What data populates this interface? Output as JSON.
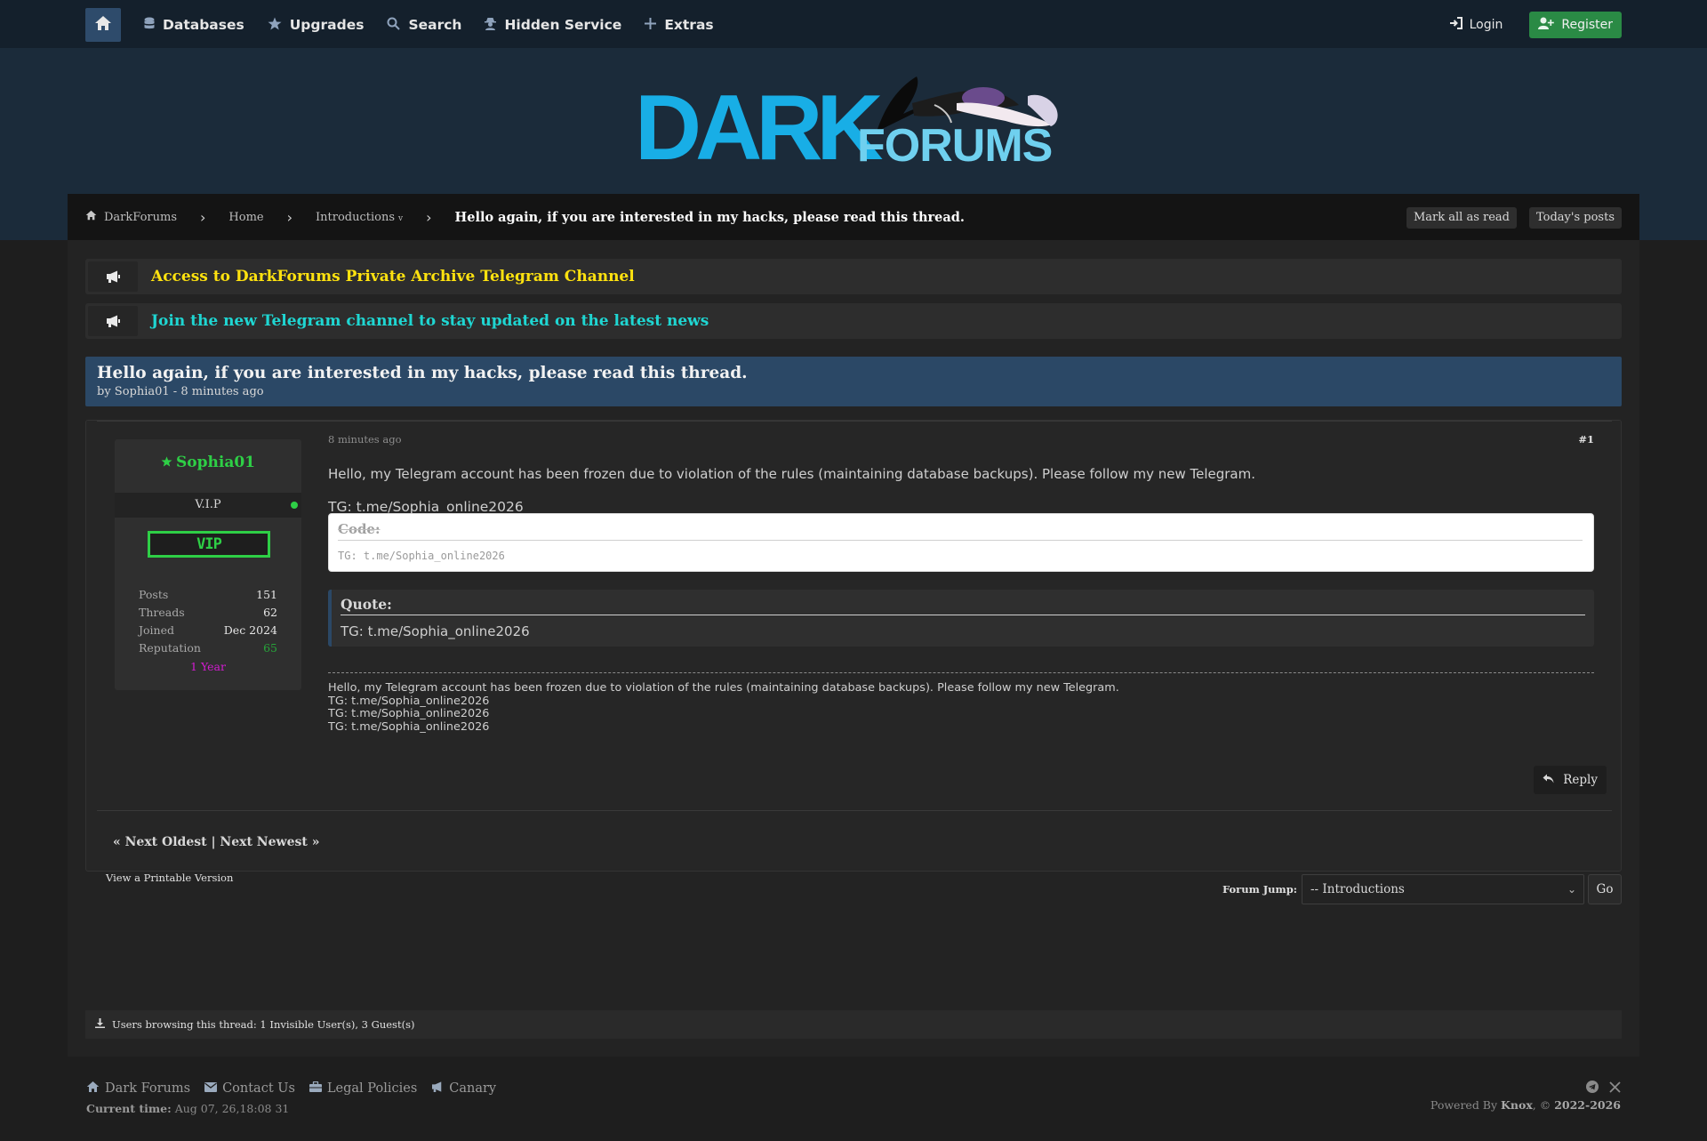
{
  "nav": {
    "items": [
      {
        "label": "Databases",
        "icon": "database-icon"
      },
      {
        "label": "Upgrades",
        "icon": "star-icon"
      },
      {
        "label": "Search",
        "icon": "search-icon"
      },
      {
        "label": "Hidden Service",
        "icon": "spy-icon"
      },
      {
        "label": "Extras",
        "icon": "plus-icon"
      }
    ],
    "login": "Login",
    "register": "Register"
  },
  "logo": {
    "dark": "DARK",
    "forums": "FORUMS"
  },
  "breadcrumb": {
    "root": "DarkForums",
    "home": "Home",
    "section": "Introductions",
    "section_caret": "v",
    "current": "Hello again, if you are interested in my hacks, please read this thread.",
    "mark_read": "Mark all as read",
    "todays_posts": "Today's posts"
  },
  "announcements": [
    {
      "text": "Access to DarkForums Private Archive Telegram Channel",
      "color": "#ffe20f"
    },
    {
      "text": "Join the new Telegram channel to stay updated on the latest news",
      "color": "#1fd6d2"
    }
  ],
  "thread": {
    "title": "Hello again, if you are interested in my hacks, please read this thread.",
    "meta": "by Sophia01 - 8 minutes ago"
  },
  "post": {
    "username": "Sophia01",
    "rank": "V.I.P",
    "badge": "VIP",
    "stats": [
      {
        "label": "Posts",
        "value": "151"
      },
      {
        "label": "Threads",
        "value": "62"
      },
      {
        "label": "Joined",
        "value": "Dec 2024"
      },
      {
        "label": "Reputation",
        "value": "65"
      }
    ],
    "tenure": "1 Year",
    "date": "8 minutes ago",
    "number": "#1",
    "line1": "Hello, my Telegram account has been frozen due to violation of the rules (maintaining database backups). Please follow my new Telegram.",
    "line2": "TG: t.me/Sophia_online2026",
    "code_title": "Code:",
    "code_body": "TG: t.me/Sophia_online2026",
    "quote_title": "Quote:",
    "quote_body": "TG: t.me/Sophia_online2026",
    "signature": [
      "Hello, my Telegram account has been frozen due to violation of the rules (maintaining database backups). Please follow my new Telegram.",
      "TG: t.me/Sophia_online2026",
      "TG: t.me/Sophia_online2026",
      "TG: t.me/Sophia_online2026"
    ],
    "reply": "Reply"
  },
  "pagination": {
    "next_links": "« Next Oldest | Next Newest »"
  },
  "printable": "View a Printable Version",
  "forum_jump": {
    "label": "Forum Jump:",
    "selected": "-- Introductions",
    "go": "Go"
  },
  "browsing": "Users browsing this thread: 1 Invisible User(s), 3 Guest(s)",
  "footer": {
    "links": [
      {
        "label": "Dark Forums",
        "icon": "home-icon"
      },
      {
        "label": "Contact Us",
        "icon": "envelope-icon"
      },
      {
        "label": "Legal Policies",
        "icon": "briefcase-icon"
      },
      {
        "label": "Canary",
        "icon": "megaphone-icon"
      }
    ],
    "current_time_label": "Current time:",
    "current_time": "Aug 07, 26,18:08 31",
    "powered_prefix": "Powered By",
    "powered_by": "Knox",
    "copyright": ", ©",
    "years": "2022-2026"
  },
  "colors": {
    "accent": "#2b4866",
    "online": "#2ecf46",
    "register": "#2a8a45",
    "logo": "#18aee6"
  }
}
